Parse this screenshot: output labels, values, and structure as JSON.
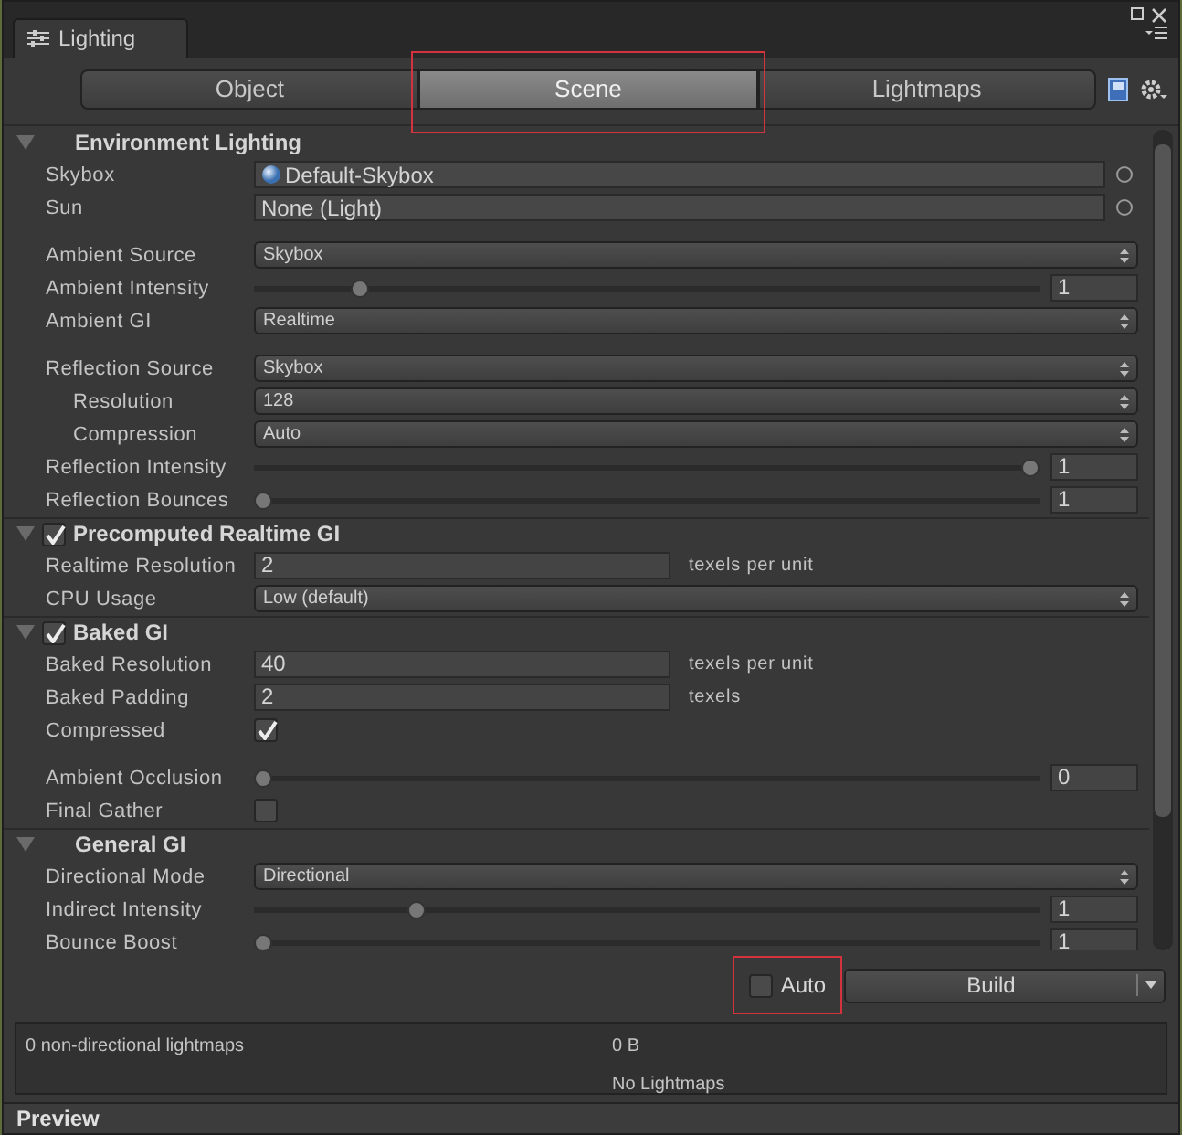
{
  "window": {
    "title": "Lighting"
  },
  "tabs": [
    {
      "label": "Object",
      "selected": false,
      "highlighted": false
    },
    {
      "label": "Scene",
      "selected": true,
      "highlighted": true
    },
    {
      "label": "Lightmaps",
      "selected": false,
      "highlighted": false
    }
  ],
  "sections": [
    {
      "title": "Environment Lighting",
      "kind": "plain",
      "expanded": true,
      "rows": [
        {
          "kind": "asset",
          "label": "Skybox",
          "value": "Default-Skybox"
        },
        {
          "kind": "object",
          "label": "Sun",
          "value": "None (Light)"
        },
        {
          "kind": "gap"
        },
        {
          "kind": "dropdown",
          "label": "Ambient Source",
          "value": "Skybox"
        },
        {
          "kind": "slider",
          "label": "Ambient Intensity",
          "level": 0.125,
          "value": "1"
        },
        {
          "kind": "dropdown",
          "label": "Ambient GI",
          "value": "Realtime"
        },
        {
          "kind": "gap"
        },
        {
          "kind": "dropdown",
          "label": "Reflection Source",
          "value": "Skybox",
          "children": [
            {
              "kind": "dropdown",
              "label": "Resolution",
              "value": "128"
            },
            {
              "kind": "dropdown",
              "label": "Compression",
              "value": "Auto"
            }
          ]
        },
        {
          "kind": "slider",
          "label": "Reflection Intensity",
          "level": 1,
          "value": "1"
        },
        {
          "kind": "slider",
          "label": "Reflection Bounces",
          "level": 0,
          "value": "1"
        }
      ]
    },
    {
      "title": "Precomputed Realtime GI",
      "kind": "toggle",
      "checked": true,
      "expanded": true,
      "rows": [
        {
          "kind": "number",
          "label": "Realtime Resolution",
          "value": "2",
          "unit": "texels per unit"
        },
        {
          "kind": "dropdown",
          "label": "CPU Usage",
          "value": "Low (default)"
        }
      ]
    },
    {
      "title": "Baked GI",
      "kind": "toggle",
      "checked": true,
      "expanded": true,
      "rows": [
        {
          "kind": "number",
          "label": "Baked Resolution",
          "value": "40",
          "unit": "texels per unit"
        },
        {
          "kind": "number",
          "label": "Baked Padding",
          "value": "2",
          "unit": "texels"
        },
        {
          "kind": "checkbox",
          "label": "Compressed",
          "checked": true
        },
        {
          "kind": "gap"
        },
        {
          "kind": "slider",
          "label": "Ambient Occlusion",
          "level": 0,
          "value": "0"
        },
        {
          "kind": "checkbox",
          "label": "Final Gather",
          "checked": false
        }
      ]
    },
    {
      "title": "General GI",
      "kind": "plain",
      "expanded": true,
      "rows": [
        {
          "kind": "dropdown",
          "label": "Directional Mode",
          "value": "Directional"
        },
        {
          "kind": "slider",
          "label": "Indirect Intensity",
          "level": 0.2,
          "value": "1"
        },
        {
          "kind": "slider",
          "label": "Bounce Boost",
          "level": 0,
          "value": "1"
        }
      ]
    }
  ],
  "auto": {
    "label": "Auto",
    "checked": false,
    "highlighted": true
  },
  "build": {
    "label": "Build"
  },
  "stats": {
    "count": "0 non-directional lightmaps",
    "size": "0 B",
    "status": "No Lightmaps"
  },
  "preview": {
    "title": "Preview"
  }
}
